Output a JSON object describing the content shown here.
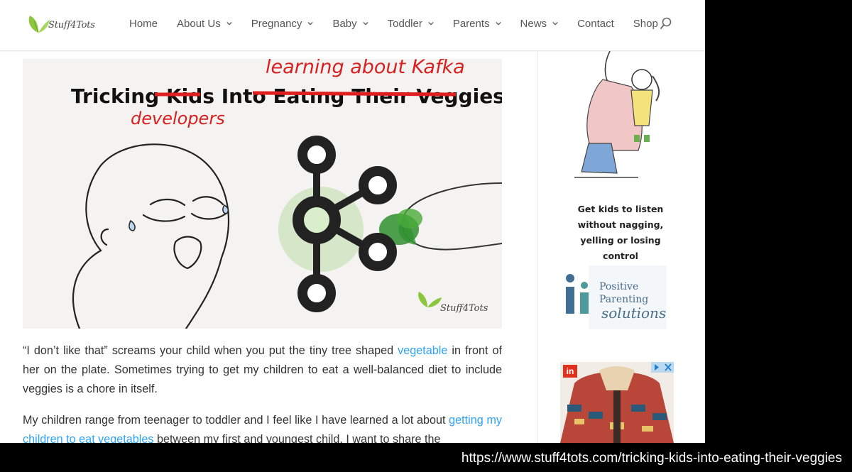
{
  "brand": {
    "name": "Stuff4Tots",
    "colors": {
      "leaf": "#8cc63f",
      "accent": "#e6762b",
      "nav_text": "#555555",
      "link": "#2ea3f2"
    }
  },
  "nav": {
    "items": [
      {
        "label": "Home",
        "dropdown": false
      },
      {
        "label": "About Us",
        "dropdown": true
      },
      {
        "label": "Pregnancy",
        "dropdown": true
      },
      {
        "label": "Baby",
        "dropdown": true
      },
      {
        "label": "Toddler",
        "dropdown": true
      },
      {
        "label": "Parents",
        "dropdown": true
      },
      {
        "label": "News",
        "dropdown": true
      },
      {
        "label": "Contact",
        "dropdown": false
      },
      {
        "label": "Shop",
        "dropdown": false
      }
    ],
    "search_icon": "search-icon"
  },
  "hero": {
    "title_start": "Tricking ",
    "title_struck_1": "Kids",
    "title_mid": " Into ",
    "title_struck_2": "Eating Their Veggies",
    "title_end": "!",
    "overlay_top": "learning about Kafka",
    "overlay_bottom": "developers",
    "watermark": "Stuff4Tots"
  },
  "article": {
    "p1_before": "“I don’t like that” screams your child when you put the tiny tree shaped ",
    "p1_link": "vegetable",
    "p1_after": " in front of her on the plate. Sometimes trying to get my children to eat a well-balanced diet to include veggies is a chore in itself.",
    "p2_before": "My children range from teenager to toddler and I feel like I have learned a lot about ",
    "p2_link": "getting my children to eat vegetables",
    "p2_after": " between my first and youngest child. I want to share the"
  },
  "sidebar": {
    "promo_line1": "Get kids to listen",
    "promo_line2": "without nagging,",
    "promo_line3": "yelling or losing",
    "promo_line4": "control",
    "pp_word1": "Positive",
    "pp_word2": "Parenting",
    "pp_word3": "solutions",
    "ad_badge": "in"
  },
  "caption": {
    "url": "https://www.stuff4tots.com/tricking-kids-into-eating-their-veggies"
  }
}
